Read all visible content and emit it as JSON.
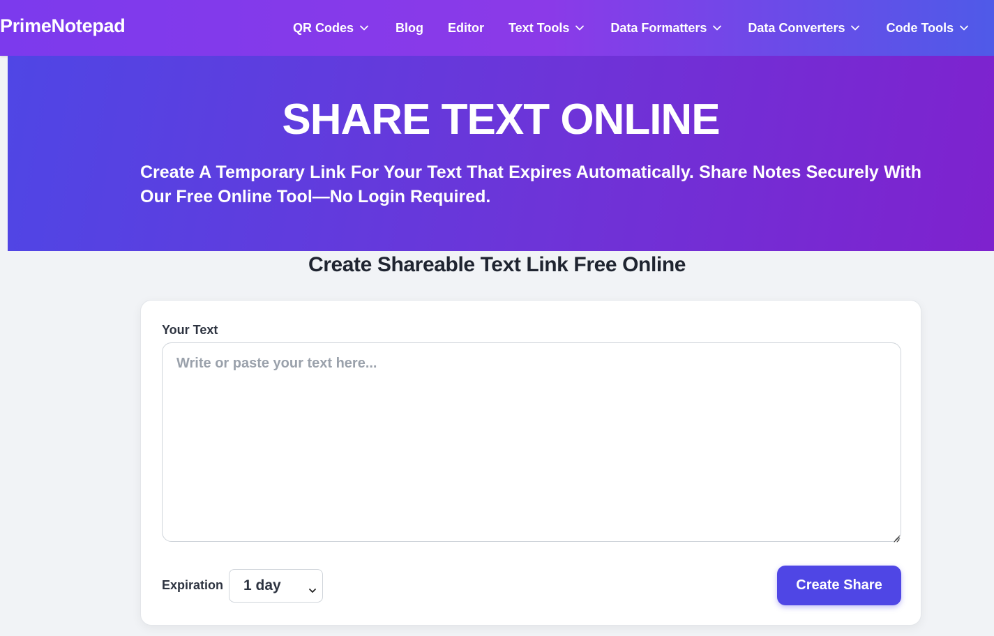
{
  "header": {
    "logo": "PrimeNotepad",
    "nav": [
      {
        "label": "QR Codes",
        "dropdown": true
      },
      {
        "label": "Blog",
        "dropdown": false
      },
      {
        "label": "Editor",
        "dropdown": false
      },
      {
        "label": "Text Tools",
        "dropdown": true
      },
      {
        "label": "Data Formatters",
        "dropdown": true
      },
      {
        "label": "Data Converters",
        "dropdown": true
      },
      {
        "label": "Code Tools",
        "dropdown": true
      }
    ]
  },
  "hero": {
    "title": "SHARE TEXT ONLINE",
    "subtitle": "Create A Temporary Link For Your Text That Expires Automatically. Share Notes Securely With Our Free Online Tool—No Login Required."
  },
  "main": {
    "heading": "Create Shareable Text Link Free Online",
    "form": {
      "text_label": "Your Text",
      "text_value": "",
      "text_placeholder": "Write or paste your text here...",
      "expiration_label": "Expiration",
      "expiration_value": "1 day",
      "submit_label": "Create Share"
    }
  },
  "colors": {
    "accent": "#4f46e5",
    "nav_gradient_start": "#7c3aed",
    "hero_gradient_end": "#7e22ce",
    "page_bg": "#f1f3f6"
  },
  "icons": {
    "dropdown": "chevron-down-icon",
    "resize": "resize-grip-icon"
  }
}
